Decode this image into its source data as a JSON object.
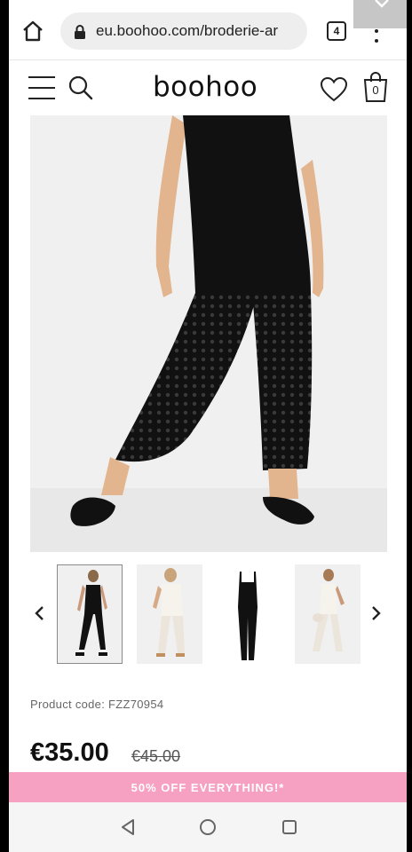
{
  "browser": {
    "url": "eu.boohoo.com/broderie-ar",
    "tab_count": "4"
  },
  "header": {
    "logo": "boohoo",
    "bag_count": "0"
  },
  "hero": {
    "alt": "Black broderie anglaise jumpsuit worn by model"
  },
  "thumbnails": [
    {
      "name": "black jumpsuit front",
      "selected": true
    },
    {
      "name": "white jumpsuit back"
    },
    {
      "name": "black jumpsuit flat"
    },
    {
      "name": "white jumpsuit front"
    }
  ],
  "product": {
    "code_label": "Product code: FZZ70954",
    "price": "€35.00",
    "old_price": "€45.00"
  },
  "promo": {
    "text": "50% OFF EVERYTHING!*"
  },
  "colors": {
    "promo": "#f7a1c2",
    "garment": "#111111"
  }
}
